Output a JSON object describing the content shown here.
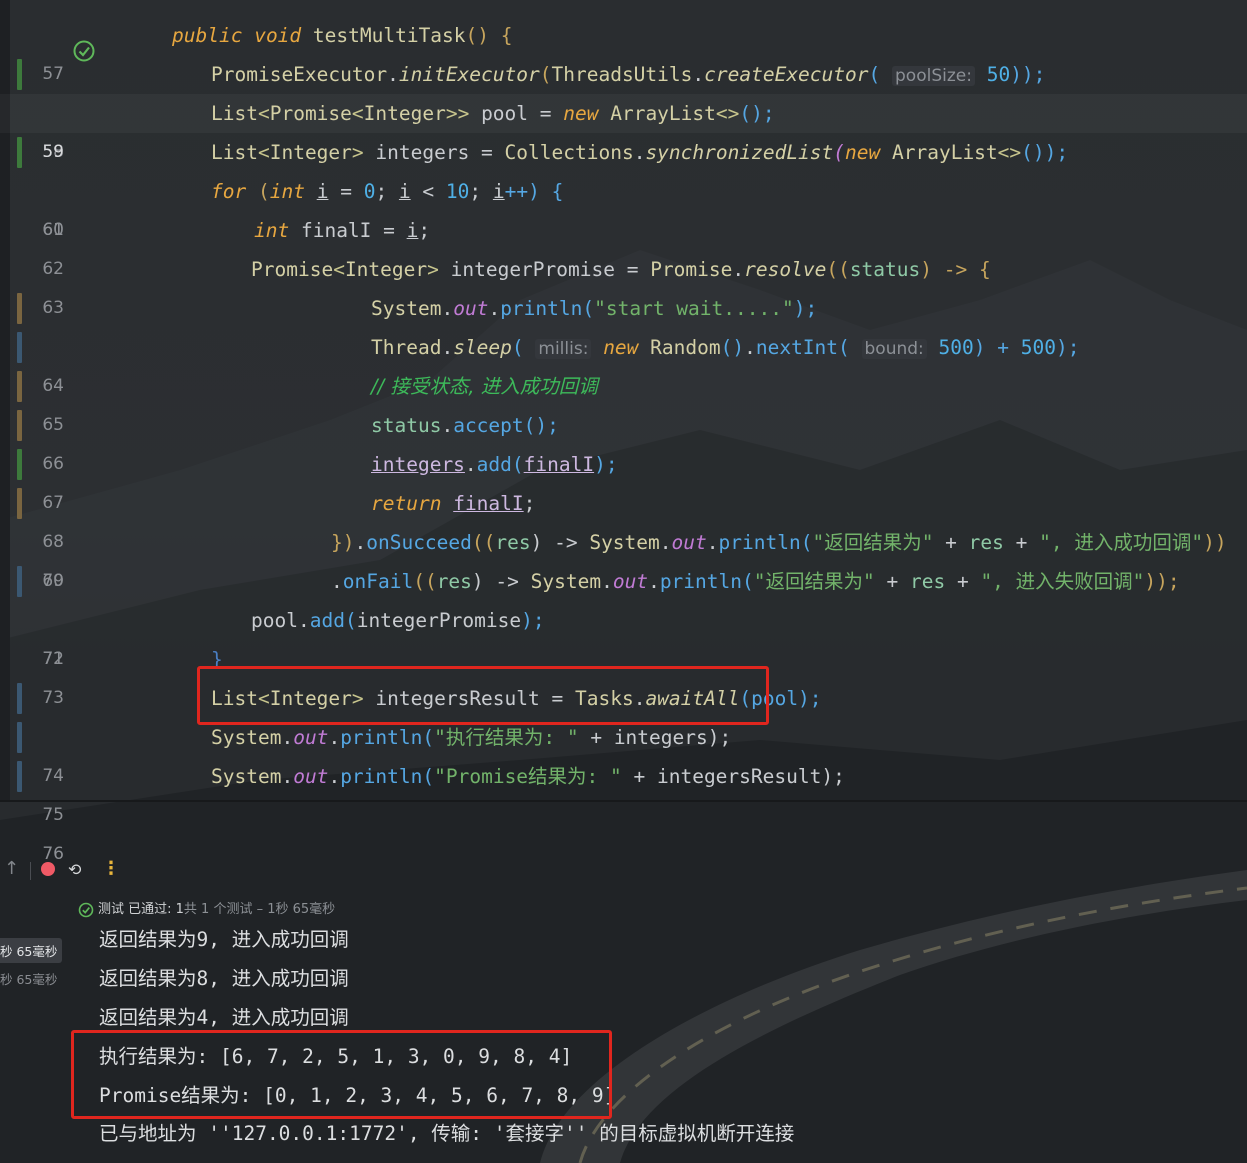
{
  "editor": {
    "lines": [
      {
        "n": "57",
        "current": false
      },
      {
        "n": "58",
        "current": false
      },
      {
        "n": "59",
        "current": true
      },
      {
        "n": "60",
        "current": false
      },
      {
        "n": "61",
        "current": false
      },
      {
        "n": "62",
        "current": false
      },
      {
        "n": "63",
        "current": false
      },
      {
        "n": "64",
        "current": false
      },
      {
        "n": "65",
        "current": false
      },
      {
        "n": "66",
        "current": false
      },
      {
        "n": "67",
        "current": false
      },
      {
        "n": "68",
        "current": false
      },
      {
        "n": "69",
        "current": false
      },
      {
        "n": "70",
        "current": false
      },
      {
        "n": "71",
        "current": false
      },
      {
        "n": "72",
        "current": false
      },
      {
        "n": "73",
        "current": false
      },
      {
        "n": "74",
        "current": false
      },
      {
        "n": "75",
        "current": false
      },
      {
        "n": "76",
        "current": false
      }
    ],
    "tokens": {
      "l57": {
        "public": "public",
        "void": "void",
        "name": " testMultiTask",
        "rest": "() {"
      },
      "l58": {
        "a": "PromiseExecutor",
        "b": ".",
        "c": "initExecutor",
        "d": "(",
        "e": "ThreadsUtils",
        "f": ".",
        "g": "createExecutor",
        "h": "( ",
        "hint": "poolSize:",
        "i": " ",
        "j": "50",
        "k": "));"
      },
      "l59": {
        "a": "List",
        "b": "<",
        "c": "Promise",
        "d": "<",
        "e": "Integer",
        "f": ">>",
        "g": " pool = ",
        "h": "new",
        "i": " ArrayList",
        "j": "<>",
        "k": "();"
      },
      "l60": {
        "a": "List",
        "b": "<",
        "c": "Integer",
        "d": ">",
        "e": " integers = ",
        "f": "Collections",
        "g": ".",
        "h": "synchronizedList",
        "i": "(",
        "j": "new",
        "k": " ArrayList",
        "l": "<>",
        "m": "());"
      },
      "l61": {
        "a": "for",
        "b": " (",
        "c": "int",
        "d": " ",
        "e": "i",
        "f": " = ",
        "g": "0",
        "h": "; ",
        "i": "i",
        "j": " < ",
        "k": "10",
        "l": "; ",
        "m": "i",
        "n": "++) {"
      },
      "l62": {
        "a": "int",
        "b": " finalI = ",
        "c": "i",
        "d": ";"
      },
      "l63": {
        "a": "Promise",
        "b": "<",
        "c": "Integer",
        "d": ">",
        "e": " integerPromise = ",
        "f": "Promise",
        "g": ".",
        "h": "resolve",
        "i": "((",
        "j": "status",
        "k": ") -> {"
      },
      "l64": {
        "a": "System",
        "b": ".",
        "c": "out",
        "d": ".",
        "e": "println",
        "f": "(",
        "g": "\"start wait.....\"",
        "h": ");"
      },
      "l65": {
        "a": "Thread",
        "b": ".",
        "c": "sleep",
        "d": "( ",
        "hint1": "millis:",
        "e": " ",
        "f": "new",
        "g": " Random",
        "h": "()",
        "i": ".",
        "j": "nextInt",
        "k": "( ",
        "hint2": "bound:",
        "l": " ",
        "m": "500",
        "n": ") + ",
        "o": "500",
        "p": ");"
      },
      "l66": {
        "a": "// 接受状态, 进入成功回调"
      },
      "l67": {
        "a": "status",
        "b": ".",
        "c": "accept",
        "d": "();"
      },
      "l68": {
        "a": "integers",
        "b": ".",
        "c": "add",
        "d": "(",
        "e": "finalI",
        "f": ");"
      },
      "l69": {
        "a": "return",
        "b": " ",
        "c": "finalI",
        "d": ";"
      },
      "l70": {
        "a": "})",
        "b": ".",
        "c": "onSucceed",
        "d": "((",
        "e": "res",
        "f": ") -> ",
        "g": "System",
        "h": ".",
        "i": "out",
        "j": ".",
        "k": "println",
        "l": "(",
        "m": "\"返回结果为\"",
        "n": " + ",
        "o": "res",
        "p": " + ",
        "q": "\", 进入成功回调\"",
        "r": "))"
      },
      "l71": {
        "a": ".",
        "b": "onFail",
        "c": "((",
        "d": "res",
        "e": ") -> ",
        "f": "System",
        "g": ".",
        "h": "out",
        "i": ".",
        "j": "println",
        "k": "(",
        "l": "\"返回结果为\"",
        "m": " + ",
        "n": "res",
        "o": " + ",
        "p": "\", 进入失败回调\"",
        "q": "));"
      },
      "l72": {
        "a": "pool",
        "b": ".",
        "c": "add",
        "d": "(",
        "e": "integerPromise",
        "f": ");"
      },
      "l73": {
        "a": "}"
      },
      "l74": {
        "a": "List",
        "b": "<",
        "c": "Integer",
        "d": ">",
        "e": " integersResult = ",
        "f": "Tasks",
        "g": ".",
        "h": "awaitAll",
        "i": "(pool);"
      },
      "l75": {
        "a": "System",
        "b": ".",
        "c": "out",
        "d": ".",
        "e": "println",
        "f": "(",
        "g": "\"执行结果为: \"",
        "h": " + integers);"
      },
      "l76": {
        "a": "System",
        "b": ".",
        "c": "out",
        "d": ".",
        "e": "println",
        "f": "(",
        "g": "\"Promise结果为: \"",
        "h": " + integersResult);"
      }
    }
  },
  "run": {
    "status_prefix": "测试 已通过: 1",
    "status_suffix": "共 1 个测试 – 1秒 65毫秒",
    "tree": [
      "秒 65毫秒",
      "秒 65毫秒"
    ],
    "output": [
      "返回结果为9, 进入成功回调",
      "返回结果为8, 进入成功回调",
      "返回结果为4, 进入成功回调",
      "执行结果为: [6, 7, 2, 5, 1, 3, 0, 9, 8, 4]",
      "Promise结果为: [0, 1, 2, 3, 4, 5, 6, 7, 8, 9]",
      "已与地址为 ''127.0.0.1:1772', 传输: '套接字'' 的目标虚拟机断开连接"
    ]
  },
  "colors": {
    "highlight_box": "#e0261e",
    "keyword": "#e7a740",
    "string": "#72b36a",
    "method": "#55a7e3",
    "stop_button": "#f05a66"
  },
  "icons": [
    "test-passed-icon",
    "stop-icon",
    "rerun-icon",
    "more-icon",
    "up-arrow-icon"
  ]
}
